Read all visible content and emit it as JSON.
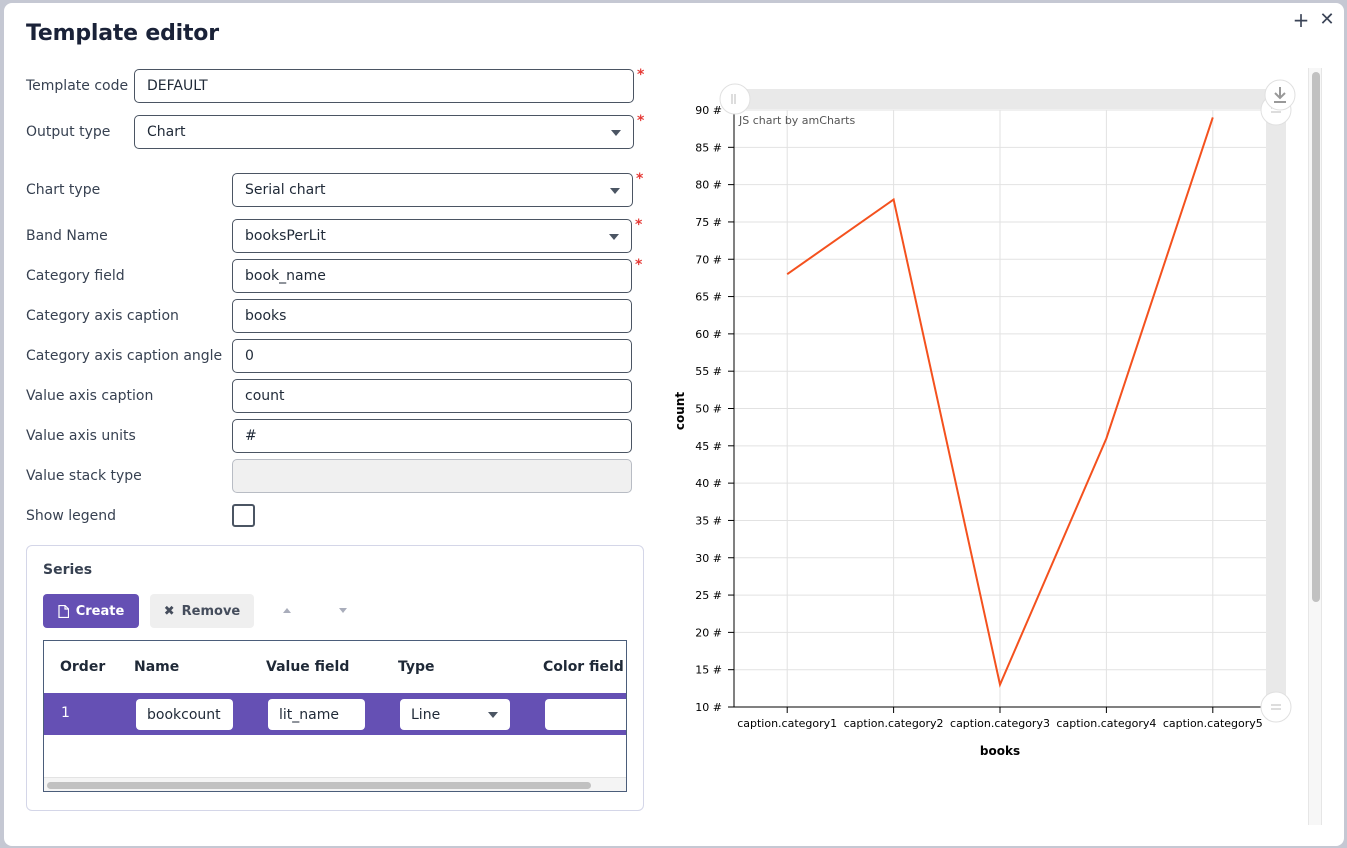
{
  "dialog": {
    "title": "Template editor",
    "maximize_icon": "+",
    "close_icon": "✕"
  },
  "form": {
    "template_code": {
      "label": "Template code",
      "value": "DEFAULT",
      "required": true
    },
    "output_type": {
      "label": "Output type",
      "value": "Chart",
      "required": true
    },
    "chart_type": {
      "label": "Chart type",
      "value": "Serial chart",
      "required": true
    },
    "band_name": {
      "label": "Band Name",
      "value": "booksPerLit",
      "required": true
    },
    "category_field": {
      "label": "Category field",
      "value": "book_name",
      "required": true
    },
    "category_axis_caption": {
      "label": "Category axis caption",
      "value": "books"
    },
    "category_axis_caption_angle": {
      "label": "Category axis caption angle",
      "value": "0"
    },
    "value_axis_caption": {
      "label": "Value axis caption",
      "value": "count"
    },
    "value_axis_units": {
      "label": "Value axis units",
      "value": "#"
    },
    "value_stack_type": {
      "label": "Value stack type",
      "value": ""
    },
    "show_legend": {
      "label": "Show legend",
      "checked": false
    },
    "required_mark": "*"
  },
  "series": {
    "title": "Series",
    "create_label": "Create",
    "remove_label": "Remove",
    "columns": [
      "Order",
      "Name",
      "Value field",
      "Type",
      "Color field"
    ],
    "rows": [
      {
        "order": "1",
        "name": "bookcount",
        "value_field": "lit_name",
        "type": "Line",
        "color_field": ""
      }
    ]
  },
  "colors": {
    "accent": "#6550b4",
    "line": "#f4511e",
    "required": "#e53935"
  },
  "chart_data": {
    "type": "line",
    "credit": "JS chart by amCharts",
    "categories": [
      "caption.category1",
      "caption.category2",
      "caption.category3",
      "caption.category4",
      "caption.category5"
    ],
    "series": [
      {
        "name": "bookcount",
        "values": [
          68,
          78,
          13,
          46,
          89
        ],
        "color": "#f4511e"
      }
    ],
    "xlabel": "books",
    "ylabel": "count",
    "y_unit": "#",
    "ylim": [
      10,
      90
    ],
    "y_ticks": [
      10,
      15,
      20,
      25,
      30,
      35,
      40,
      45,
      50,
      55,
      60,
      65,
      70,
      75,
      80,
      85,
      90
    ],
    "grid": true,
    "legend": "none",
    "scrollbars": {
      "horizontal": true,
      "vertical": true
    }
  }
}
